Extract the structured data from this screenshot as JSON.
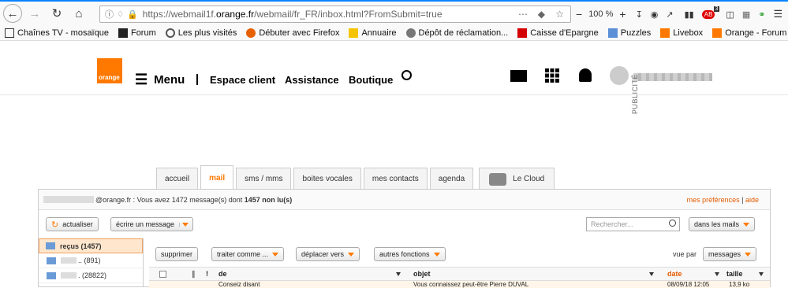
{
  "browser": {
    "url_prefix": "https://webmail1f.",
    "url_host": "orange.fr",
    "url_suffix": "/webmail/fr_FR/inbox.html?FromSubmit=true",
    "zoom": "100 %",
    "badge_count": "3"
  },
  "bookmarks": [
    {
      "label": "Chaînes TV - mosaïque",
      "color": "#333333"
    },
    {
      "label": "Forum",
      "color": "#222222"
    },
    {
      "label": "Les plus visités",
      "color": "#555555"
    },
    {
      "label": "Débuter avec Firefox",
      "color": "#e66000"
    },
    {
      "label": "Annuaire",
      "color": "#f5c400"
    },
    {
      "label": "Dépôt de réclamation...",
      "color": "#666666"
    },
    {
      "label": "Caisse d'Epargne",
      "color": "#d40000"
    },
    {
      "label": "Puzzles",
      "color": "#5b8fd6"
    },
    {
      "label": "Livebox",
      "color": "#ff7900"
    },
    {
      "label": "Orange - Forum",
      "color": "#ff7900"
    }
  ],
  "header": {
    "logo_text": "orange",
    "menu": "Menu",
    "links": [
      "Espace client",
      "Assistance",
      "Boutique"
    ]
  },
  "ad_label": "PUBLICITÉ",
  "tabs": [
    "accueil",
    "mail",
    "sms / mms",
    "boites vocales",
    "mes contacts",
    "agenda",
    "Le Cloud"
  ],
  "info": {
    "email_suffix": "@orange.fr : Vous avez 1472 message(s) dont",
    "unread": "1457 non lu(s)",
    "prefs": "mes préférences",
    "separator": "|",
    "help": "aide"
  },
  "toolbar": {
    "refresh": "actualiser",
    "compose": "écrire un message",
    "search_placeholder": "Rechercher...",
    "search_scope": "dans les mails"
  },
  "folders": [
    {
      "label": "reçus (1457)"
    },
    {
      "label": ".. (891)"
    },
    {
      "label": ". (28822)"
    }
  ],
  "actions": {
    "delete": "supprimer",
    "mark": "traiter comme ...",
    "move": "déplacer vers",
    "more": "autres fonctions",
    "view_by": "vue par",
    "view_mode": "messages"
  },
  "columns": {
    "from": "de",
    "subject": "objet",
    "date": "date",
    "size": "taille"
  },
  "first_row": {
    "from": "Conseiz disant",
    "subject": "Vous connaissez peut-être Pierre DUVAL",
    "date": "08/09/18 12:05",
    "size": "13,9 ko"
  }
}
